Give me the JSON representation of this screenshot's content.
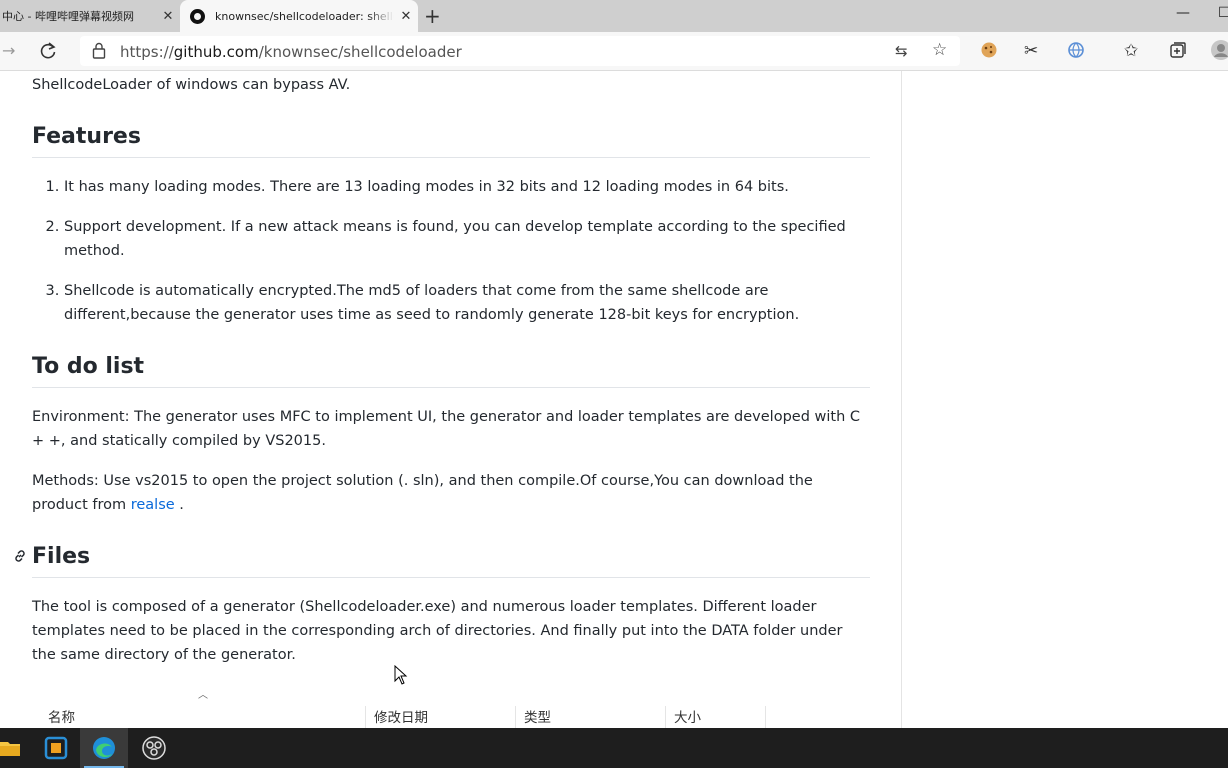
{
  "browser": {
    "tabs": [
      {
        "title": "中心 - 哔哩哔哩弹幕视频网",
        "close": "✕"
      },
      {
        "title": "knownsec/shellcodeloader: shellc",
        "close": "✕"
      }
    ],
    "new_tab": "+",
    "url_prefix": "https://",
    "url_host": "github.com",
    "url_path": "/knownsec/shellcodeloader",
    "window_controls": {
      "minimize": "—",
      "maximize": "☐",
      "close": "✕"
    }
  },
  "article": {
    "intro": "ShellcodeLoader of windows can bypass AV.",
    "features_heading": "Features",
    "features": [
      "It has many loading modes. There are 13 loading modes in 32 bits and 12 loading modes in 64 bits.",
      "Support development. If a new attack means is found, you can develop template according to the specified method.",
      "Shellcode is automatically encrypted.The md5 of loaders that come from the same shellcode are different,because the generator uses time as seed to randomly generate 128-bit keys for encryption."
    ],
    "todo_heading": "To do list",
    "environment": "Environment: The generator uses MFC to implement UI, the generator and loader templates are developed with C + +, and statically compiled by VS2015.",
    "methods_text": "Methods: Use vs2015 to open the project solution (. sln), and then compile.Of course,You can download the product from",
    "methods_link": "realse",
    "methods_end": " .",
    "files_heading": "Files",
    "files_text": "The tool is composed of a generator (Shellcodeloader.exe) and numerous loader templates. Different loader templates need to be placed in the corresponding arch of directories. And finally put into the DATA folder under the same directory of the generator.",
    "table_columns": [
      "名称",
      "修改日期",
      "类型",
      "大小"
    ]
  },
  "icons": {
    "back": "arrow-left-icon",
    "reload": "reload-icon",
    "lock": "lock-icon",
    "translate": "translate-icon",
    "favorite": "star-icon",
    "cookie": "cookie-extension-icon",
    "scissors": "scissors-extension-icon",
    "globe": "globe-extension-icon",
    "favorites": "favorites-icon",
    "collections": "collections-icon",
    "profile": "profile-icon"
  }
}
